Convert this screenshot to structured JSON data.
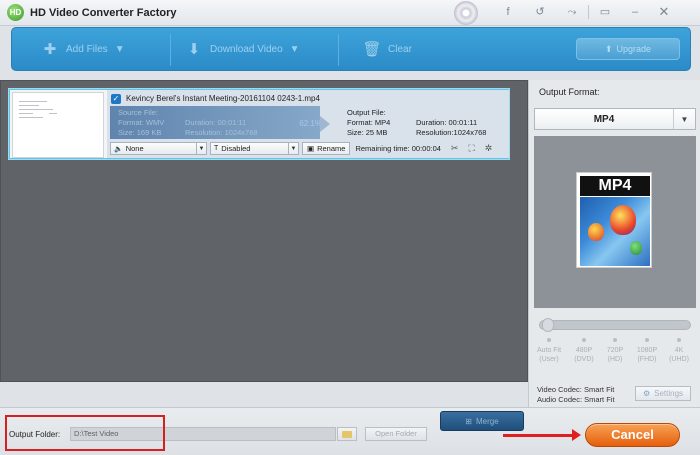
{
  "titlebar": {
    "app_title": "HD Video Converter Factory",
    "logo_text": "HD",
    "icons": [
      "disc-icon",
      "facebook-icon",
      "undo-icon",
      "redo-icon",
      "chat-icon",
      "minimize-icon",
      "close-icon"
    ]
  },
  "toolbar": {
    "add_files": "Add Files",
    "download_video": "Download Video",
    "clear": "Clear",
    "upgrade": "Upgrade"
  },
  "file_item": {
    "checked": true,
    "name": "Kevincy Berel's Instant Meeting-20161104 0243-1.mp4",
    "source": {
      "header": "Source File:",
      "format": "Format: WMV",
      "duration": "Duration: 00:01:11",
      "size": "Size: 169 KB",
      "resolution": "Resolution: 1024x768",
      "progress": "62.1%"
    },
    "output": {
      "header": "Output File:",
      "format": "Format: MP4",
      "duration": "Duration: 00:01:11",
      "size": "Size: 25 MB",
      "resolution": "Resolution:1024x768"
    },
    "audio_select": "None",
    "subtitle_select": "Disabled",
    "rename": "Rename",
    "remaining": "Remaining time: 00:00:04"
  },
  "right_panel": {
    "output_format_label": "Output Format:",
    "format_value": "MP4",
    "tile_caption": "MP4",
    "quality_labels": [
      {
        "top": "Auto Fit",
        "bottom": "(User)"
      },
      {
        "top": "480P",
        "bottom": "(DVD)"
      },
      {
        "top": "720P",
        "bottom": "(HD)"
      },
      {
        "top": "1080P",
        "bottom": "(FHD)"
      },
      {
        "top": "4K",
        "bottom": "(UHD)"
      }
    ],
    "video_codec": "Video Codec: Smart Fit",
    "audio_codec": "Audio Codec: Smart Fit",
    "settings": "Settings"
  },
  "bottom": {
    "merge": "Merge",
    "output_folder_label": "Output Folder:",
    "output_folder_value": "D:\\Test Video",
    "open_folder": "Open Folder",
    "cancel": "Cancel"
  },
  "colors": {
    "toolbar_blue": "#3ea3da",
    "highlight_red": "#d61f1f",
    "cancel_orange": "#e55f0c"
  }
}
